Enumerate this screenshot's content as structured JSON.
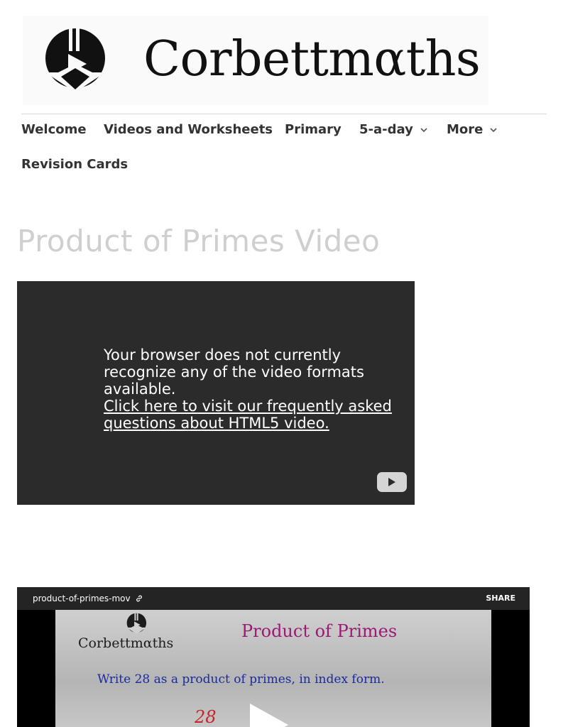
{
  "site": {
    "logo_text": "Corbettmαths"
  },
  "nav": {
    "items": [
      {
        "label": "Welcome"
      },
      {
        "label": "Videos and Worksheets"
      },
      {
        "label": "Primary"
      },
      {
        "label": "5-a-day",
        "has_dropdown": true
      },
      {
        "label": "More",
        "has_dropdown": true
      },
      {
        "label": "Revision Cards"
      }
    ]
  },
  "page": {
    "title": "Product of Primes Video"
  },
  "video_fallback": {
    "message": "Your browser does not currently recognize any of the video formats available.",
    "link_text": "Click here to visit our frequently asked questions about HTML5 video."
  },
  "embed": {
    "name": "product-of-primes-mov",
    "share_label": "SHARE",
    "slide": {
      "logo_text": "Corbettmαths",
      "title": "Product of Primes",
      "question": "Write 28 as a product of primes, in index form.",
      "number": "28"
    }
  },
  "colors": {
    "nav_text": "#333333",
    "title_text": "#cfcfcf",
    "video_bg": "#2b2b2b",
    "slide_title": "#9b1a75",
    "slide_question": "#1b2a9c",
    "slide_number": "#c4262d"
  },
  "icons": {
    "logo": "corbettmaths-logo-icon",
    "dropdown": "chevron-down-icon",
    "play": "play-icon",
    "link": "link-icon"
  }
}
